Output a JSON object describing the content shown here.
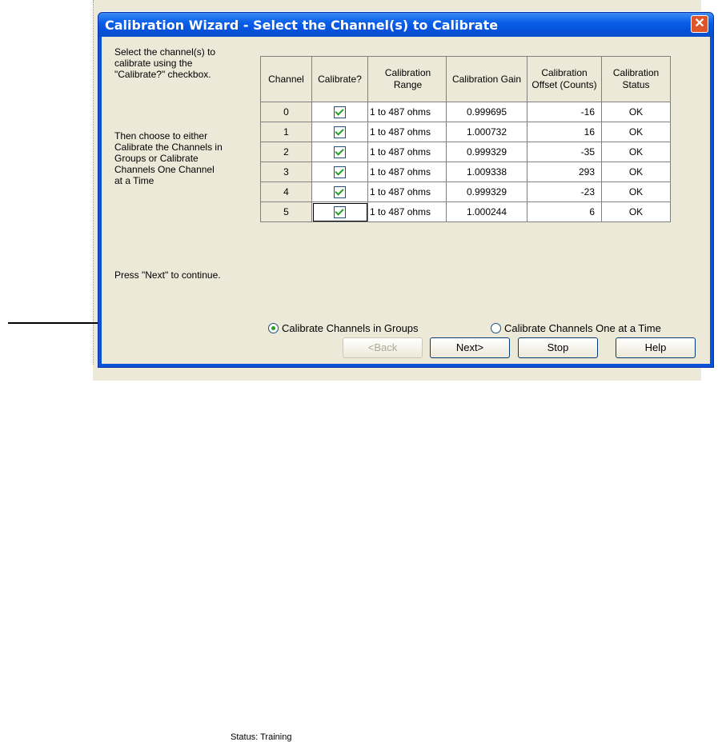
{
  "window": {
    "title": "Calibration Wizard - Select the Channel(s) to Calibrate",
    "close_glyph": "✕"
  },
  "instructions": {
    "line1": "Select the channel(s) to",
    "line2": "calibrate using the",
    "line3": "\"Calibrate?\" checkbox.",
    "line4": "Then choose to either",
    "line5": "Calibrate the Channels in",
    "line6": "Groups or Calibrate",
    "line7": "Channels One Channel",
    "line8": "at a Time",
    "continue": "Press \"Next\" to continue."
  },
  "table": {
    "headers": [
      "Channel",
      "Calibrate?",
      "Calibration Range",
      "Calibration Gain",
      "Calibration Offset (Counts)",
      "Calibration Status"
    ],
    "rows": [
      {
        "channel": "0",
        "calibrate": true,
        "range": "1 to 487 ohms",
        "gain": "0.999695",
        "offset": "-16",
        "status": "OK"
      },
      {
        "channel": "1",
        "calibrate": true,
        "range": "1 to 487 ohms",
        "gain": "1.000732",
        "offset": "16",
        "status": "OK"
      },
      {
        "channel": "2",
        "calibrate": true,
        "range": "1 to 487 ohms",
        "gain": "0.999329",
        "offset": "-35",
        "status": "OK"
      },
      {
        "channel": "3",
        "calibrate": true,
        "range": "1 to 487 ohms",
        "gain": "1.009338",
        "offset": "293",
        "status": "OK"
      },
      {
        "channel": "4",
        "calibrate": true,
        "range": "1 to 487 ohms",
        "gain": "0.999329",
        "offset": "-23",
        "status": "OK"
      },
      {
        "channel": "5",
        "calibrate": true,
        "range": "1 to 487 ohms",
        "gain": "1.000244",
        "offset": "6",
        "status": "OK"
      }
    ]
  },
  "options": {
    "groups_label": "Calibrate Channels in Groups",
    "groups_selected": true,
    "one_label": "Calibrate Channels One at a Time",
    "one_selected": false
  },
  "buttons": {
    "back": "<Back",
    "next": "Next>",
    "stop": "Stop",
    "help": "Help"
  },
  "background": {
    "status_text": "Status: Training"
  }
}
